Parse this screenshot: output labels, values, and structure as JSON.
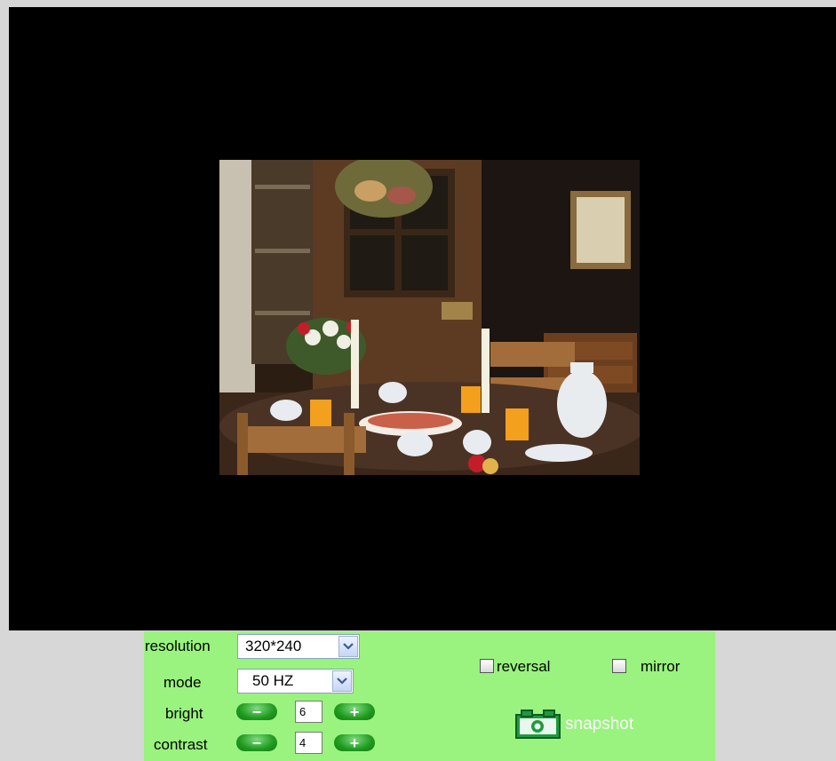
{
  "controls": {
    "resolution": {
      "label": "resolution",
      "value": "320*240"
    },
    "mode": {
      "label": "mode",
      "value": "50 HZ"
    },
    "bright": {
      "label": "bright",
      "value": "6",
      "minus": "−",
      "plus": "+"
    },
    "contrast": {
      "label": "contrast",
      "value": "4",
      "minus": "−",
      "plus": "+"
    },
    "reversal": {
      "label": "reversal",
      "checked": false
    },
    "mirror": {
      "label": "mirror",
      "checked": false
    },
    "snapshot": {
      "label": "snapshot",
      "icon": "camera-icon"
    }
  },
  "colors": {
    "viewer_background": "#000000",
    "panel_background": "#99f37e",
    "page_background": "#d7d7d7",
    "button_green": "#1f9a1f"
  }
}
